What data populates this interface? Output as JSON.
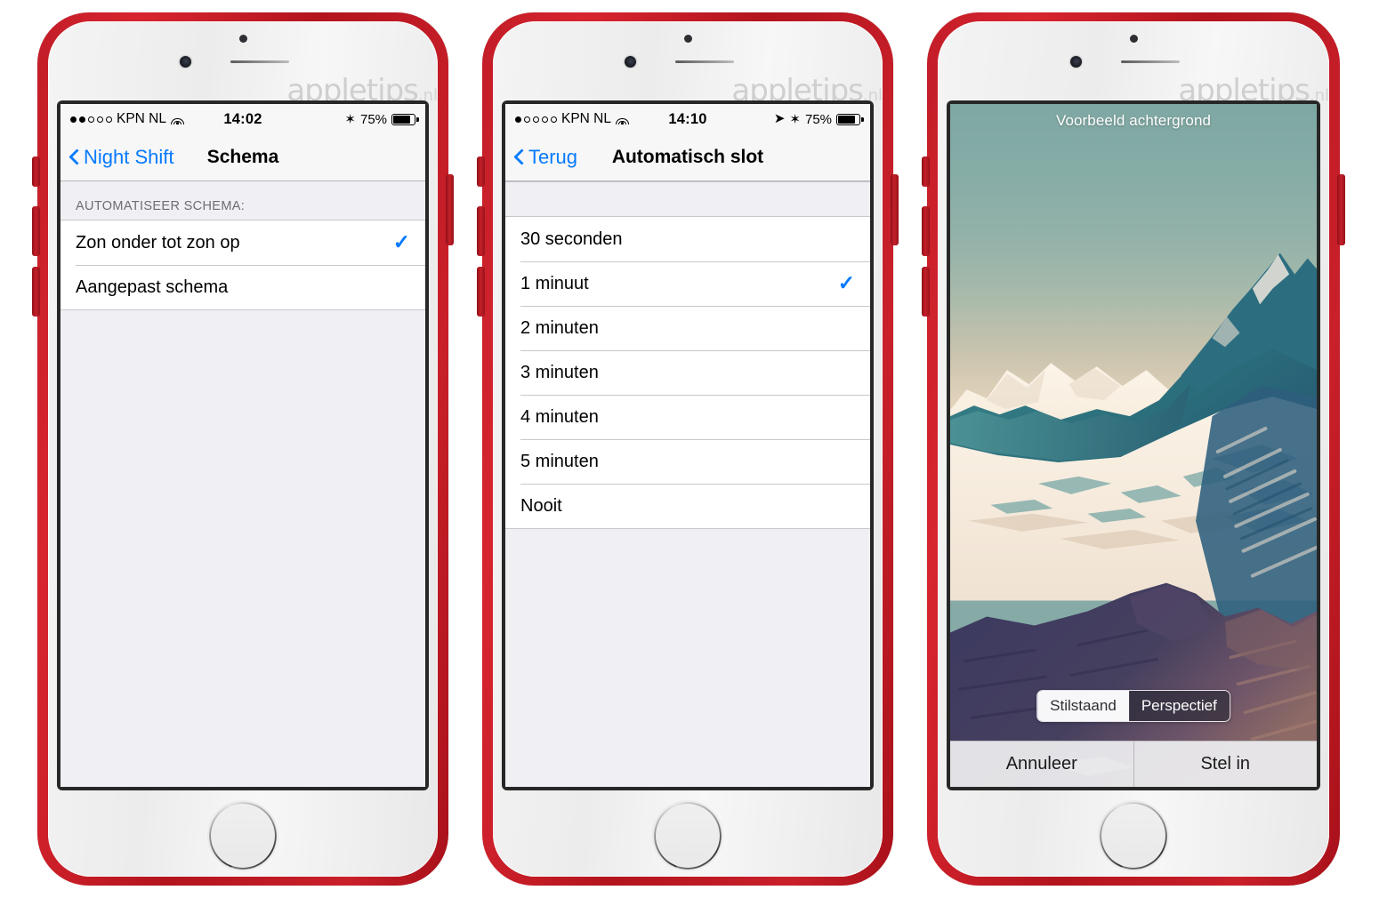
{
  "watermark": {
    "name": "appletips",
    "tld": ".nl"
  },
  "phones": [
    {
      "id": "phone-night-shift-schema",
      "status_bar": {
        "signal_dots_filled": 2,
        "signal_dots_total": 5,
        "carrier": "KPN NL",
        "wifi_icon": "wifi-icon",
        "time": "14:02",
        "location_icon": "",
        "bluetooth_icon": "✶",
        "battery_percent": "75%",
        "battery_level": 75
      },
      "nav": {
        "back_label": "Night Shift",
        "title": "Schema",
        "back_icon": "chevron-left-icon"
      },
      "section_header": "AUTOMATISEER SCHEMA:",
      "rows": [
        {
          "label": "Zon onder tot zon op",
          "checked": true
        },
        {
          "label": "Aangepast schema",
          "checked": false
        }
      ]
    },
    {
      "id": "phone-automatisch-slot",
      "status_bar": {
        "signal_dots_filled": 1,
        "signal_dots_total": 5,
        "carrier": "KPN NL",
        "wifi_icon": "wifi-icon",
        "time": "14:10",
        "location_icon": "➤",
        "bluetooth_icon": "✶",
        "battery_percent": "75%",
        "battery_level": 75
      },
      "nav": {
        "back_label": "Terug",
        "title": "Automatisch slot",
        "back_icon": "chevron-left-icon"
      },
      "section_header": "",
      "rows": [
        {
          "label": "30 seconden",
          "checked": false
        },
        {
          "label": "1 minuut",
          "checked": true
        },
        {
          "label": "2 minuten",
          "checked": false
        },
        {
          "label": "3 minuten",
          "checked": false
        },
        {
          "label": "4 minuten",
          "checked": false
        },
        {
          "label": "5 minuten",
          "checked": false
        },
        {
          "label": "Nooit",
          "checked": false
        }
      ]
    },
    {
      "id": "phone-wallpaper-preview",
      "preview_label": "Voorbeeld achtergrond",
      "segmented": [
        {
          "label": "Stilstaand",
          "selected": false
        },
        {
          "label": "Perspectief",
          "selected": true
        }
      ],
      "actions": [
        {
          "label": "Annuleer"
        },
        {
          "label": "Stel in"
        }
      ]
    }
  ],
  "colors": {
    "case_red": "#c21d27",
    "ios_blue": "#067aff",
    "table_bg": "#ffffff",
    "group_bg": "#efeff4",
    "separator": "#c8c7cc",
    "section_text": "#6d6d72",
    "navbar_bg": "#f7f7f7",
    "wallpaper_sky_top": "#7ea7a3",
    "wallpaper_sky_bottom": "#faf1e4",
    "wallpaper_mountain_teal": "#2f7f86",
    "wallpaper_ridge_purple": "#3d3a5e"
  },
  "check_glyph": "✓"
}
